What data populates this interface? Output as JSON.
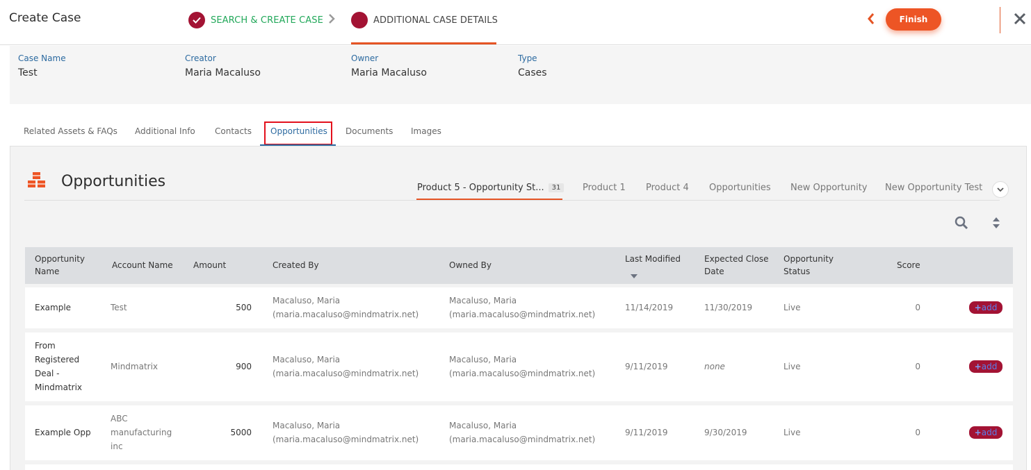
{
  "header": {
    "title": "Create Case",
    "steps": [
      {
        "label": "SEARCH & CREATE CASE",
        "status": "complete"
      },
      {
        "label": "ADDITIONAL CASE DETAILS",
        "status": "current"
      }
    ],
    "finish_label": "Finish"
  },
  "case": {
    "fields": [
      {
        "label": "Case Name",
        "value": "Test"
      },
      {
        "label": "Creator",
        "value": "Maria Macaluso"
      },
      {
        "label": "Owner",
        "value": "Maria Macaluso"
      },
      {
        "label": "Type",
        "value": "Cases"
      }
    ]
  },
  "tabs": [
    "Related Assets & FAQs",
    "Additional Info",
    "Contacts",
    "Opportunities",
    "Documents",
    "Images"
  ],
  "active_tab": "Opportunities",
  "panel": {
    "title": "Opportunities",
    "sub_tabs": [
      {
        "label": "Product 5 - Opportunity St...",
        "badge": "31"
      },
      {
        "label": "Product 1"
      },
      {
        "label": "Product 4"
      },
      {
        "label": "Opportunities"
      },
      {
        "label": "New Opportunity"
      },
      {
        "label": "New Opportunity Test"
      }
    ]
  },
  "table": {
    "columns": [
      {
        "line1": "Opportunity",
        "line2": "Name"
      },
      {
        "line1": "Account Name",
        "line2": ""
      },
      {
        "line1": "Amount",
        "line2": ""
      },
      {
        "line1": "Created By",
        "line2": ""
      },
      {
        "line1": "Owned By",
        "line2": ""
      },
      {
        "line1": "Last Modified",
        "line2": ""
      },
      {
        "line1": "Expected Close",
        "line2": "Date"
      },
      {
        "line1": "Opportunity",
        "line2": "Status"
      },
      {
        "line1": "Score",
        "line2": ""
      }
    ],
    "add_label": "add",
    "rows": [
      {
        "name": [
          "Example"
        ],
        "account": [
          "Test"
        ],
        "amount": "500",
        "created_by": [
          "Macaluso, Maria",
          "(maria.macaluso@mindmatrix.net)"
        ],
        "owned_by": [
          "Macaluso, Maria",
          "(maria.macaluso@mindmatrix.net)"
        ],
        "last_modified": "11/14/2019",
        "expected_close": "11/30/2019",
        "status": "Live",
        "score": "0"
      },
      {
        "name": [
          "From",
          "Registered",
          "Deal -",
          "Mindmatrix"
        ],
        "account": [
          "Mindmatrix"
        ],
        "amount": "900",
        "created_by": [
          "Macaluso, Maria",
          "(maria.macaluso@mindmatrix.net)"
        ],
        "owned_by": [
          "Macaluso, Maria",
          "(maria.macaluso@mindmatrix.net)"
        ],
        "last_modified": "9/11/2019",
        "expected_close": "none",
        "status": "Live",
        "score": "0"
      },
      {
        "name": [
          "Example Opp"
        ],
        "account": [
          "ABC",
          "manufacturing",
          "inc"
        ],
        "amount": "5000",
        "created_by": [
          "Macaluso, Maria",
          "(maria.macaluso@mindmatrix.net)"
        ],
        "owned_by": [
          "Macaluso, Maria",
          "(maria.macaluso@mindmatrix.net)"
        ],
        "last_modified": "9/11/2019",
        "expected_close": "9/30/2019",
        "status": "Live",
        "score": "0"
      }
    ]
  },
  "colors": {
    "accent": "#ed5525",
    "step_complete": "#22a85a",
    "step_circle": "#a31334",
    "link_blue": "#2c6aa0",
    "highlight_box": "#e3101c"
  }
}
